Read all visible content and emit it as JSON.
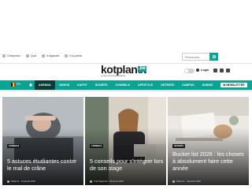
{
  "topbar": {
    "links": [
      {
        "label": "Cinéphiles",
        "icon": "film-icon"
      },
      {
        "label": "Quiz",
        "icon": "quiz-icon"
      },
      {
        "label": "Kotgames",
        "icon": "game-icon"
      },
      {
        "label": "Kot points",
        "icon": "star-icon"
      }
    ],
    "search_placeholder": "Rechercher..."
  },
  "logo": {
    "name": "kotplanet",
    "tld": ".be",
    "tagline": "Le site d'actualité étudiante"
  },
  "header": {
    "login_label": "Login"
  },
  "nav": {
    "lang": "FR",
    "items": [
      {
        "label": "AGENDA",
        "active": true
      },
      {
        "label": "VIDEOS"
      },
      {
        "label": "KAPOT"
      },
      {
        "label": "SOCIETE"
      },
      {
        "label": "CONSEILS"
      },
      {
        "label": "LIFESTYLE"
      },
      {
        "label": "DETENTE"
      },
      {
        "label": "CAMPUS"
      },
      {
        "label": "GUIDES"
      }
    ],
    "newsletter_label": "NEWSLETTER"
  },
  "cards": [
    {
      "category": "CONSEILS",
      "title": "5 astuces étudiantes contre le mal de crâne",
      "author": "Robert S.",
      "date": "21 janvier 2026"
    },
    {
      "category": "CONSEILS",
      "title": "5 conseils pour s'intégrer lors de son stage",
      "author": "Yvan Seguerrer",
      "date": "20 janvier 2026"
    },
    {
      "category": "DETENTE",
      "title": "Bucket list 2026 : les choses à absolument faire cette année",
      "author": "Robert S.",
      "date": "19 janvier 2026"
    }
  ],
  "colors": {
    "accent": "#0aa394",
    "nav_active": "#0a3b36"
  }
}
